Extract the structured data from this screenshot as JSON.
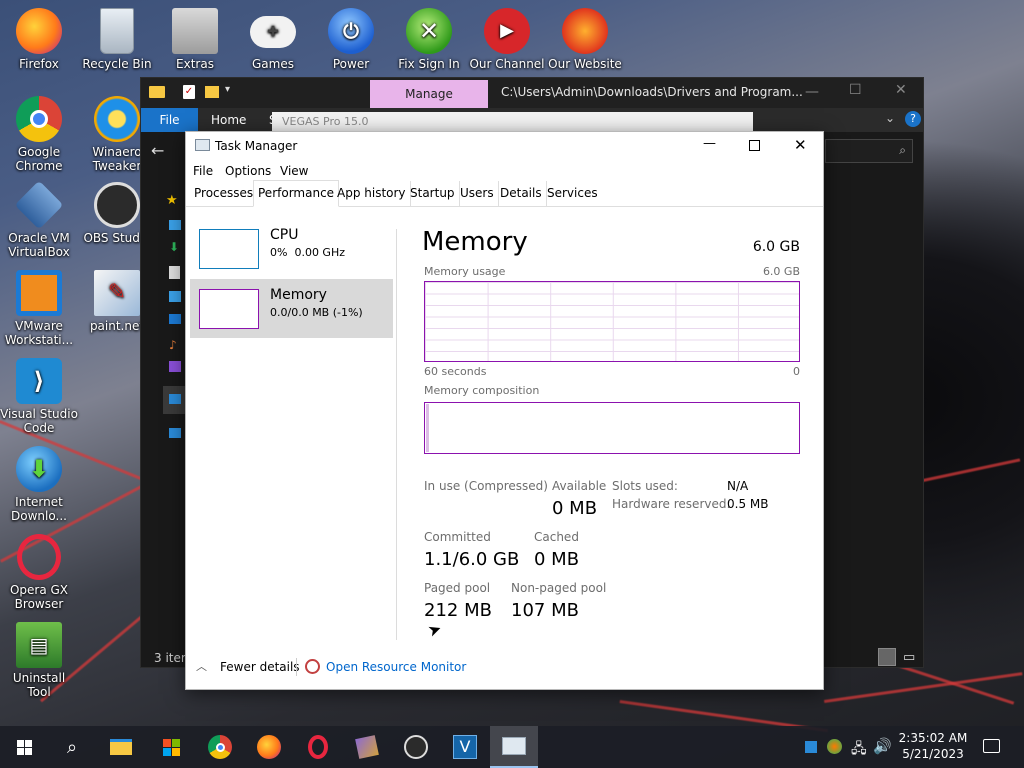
{
  "desktop": {
    "icons": [
      {
        "label": "Firefox"
      },
      {
        "label": "Recycle Bin"
      },
      {
        "label": "Extras"
      },
      {
        "label": "Games"
      },
      {
        "label": "Power"
      },
      {
        "label": "Fix Sign In"
      },
      {
        "label": "Our Channel"
      },
      {
        "label": "Our Website"
      },
      {
        "label": "Google Chrome"
      },
      {
        "label": "Winaero Tweaker"
      },
      {
        "label": "Oracle VM VirtualBox"
      },
      {
        "label": "OBS Studio"
      },
      {
        "label": "VMware Workstati..."
      },
      {
        "label": "paint.net"
      },
      {
        "label": "Visual Studio Code"
      },
      {
        "label": "Internet Downlo..."
      },
      {
        "label": "Opera GX Browser"
      },
      {
        "label": "Uninstall Tool"
      }
    ]
  },
  "explorer": {
    "manage_tab": "Manage",
    "path": "C:\\Users\\Admin\\Downloads\\Drivers and Program...",
    "file_tab": "File",
    "home_tab": "Home",
    "share_tab": "S",
    "address": "VEGAS Pro 15.0",
    "status": "3 item"
  },
  "taskmanager": {
    "title": "Task Manager",
    "menu": [
      "File",
      "Options",
      "View"
    ],
    "tabs": [
      "Processes",
      "Performance",
      "App history",
      "Startup",
      "Users",
      "Details",
      "Services"
    ],
    "sidebar": {
      "cpu": {
        "name": "CPU",
        "value": "0%  0.00 GHz"
      },
      "memory": {
        "name": "Memory",
        "value": "0.0/0.0 MB (-1%)"
      }
    },
    "main": {
      "heading": "Memory",
      "total": "6.0 GB",
      "usage_label": "Memory usage",
      "usage_max": "6.0 GB",
      "time_label": "60 seconds",
      "time_zero": "0",
      "composition_label": "Memory composition",
      "stats": {
        "in_use_label": "In use (Compressed)",
        "available_label": "Available",
        "available_value": "0 MB",
        "committed_label": "Committed",
        "committed_value": "1.1/6.0 GB",
        "cached_label": "Cached",
        "cached_value": "0 MB",
        "paged_label": "Paged pool",
        "paged_value": "212 MB",
        "nonpaged_label": "Non-paged pool",
        "nonpaged_value": "107 MB",
        "slots_label": "Slots used:",
        "slots_value": "N/A",
        "hwres_label": "Hardware reserved:",
        "hwres_value": "0.5 MB"
      }
    },
    "footer": {
      "fewer": "Fewer details",
      "resmon": "Open Resource Monitor"
    }
  },
  "taskbar": {
    "time": "2:35:02 AM",
    "date": "5/21/2023"
  },
  "colors": {
    "memory_accent": "#8b12ae",
    "cpu_accent": "#117dbb",
    "selected_bg": "#d9d9d9",
    "link": "#0066cc"
  }
}
